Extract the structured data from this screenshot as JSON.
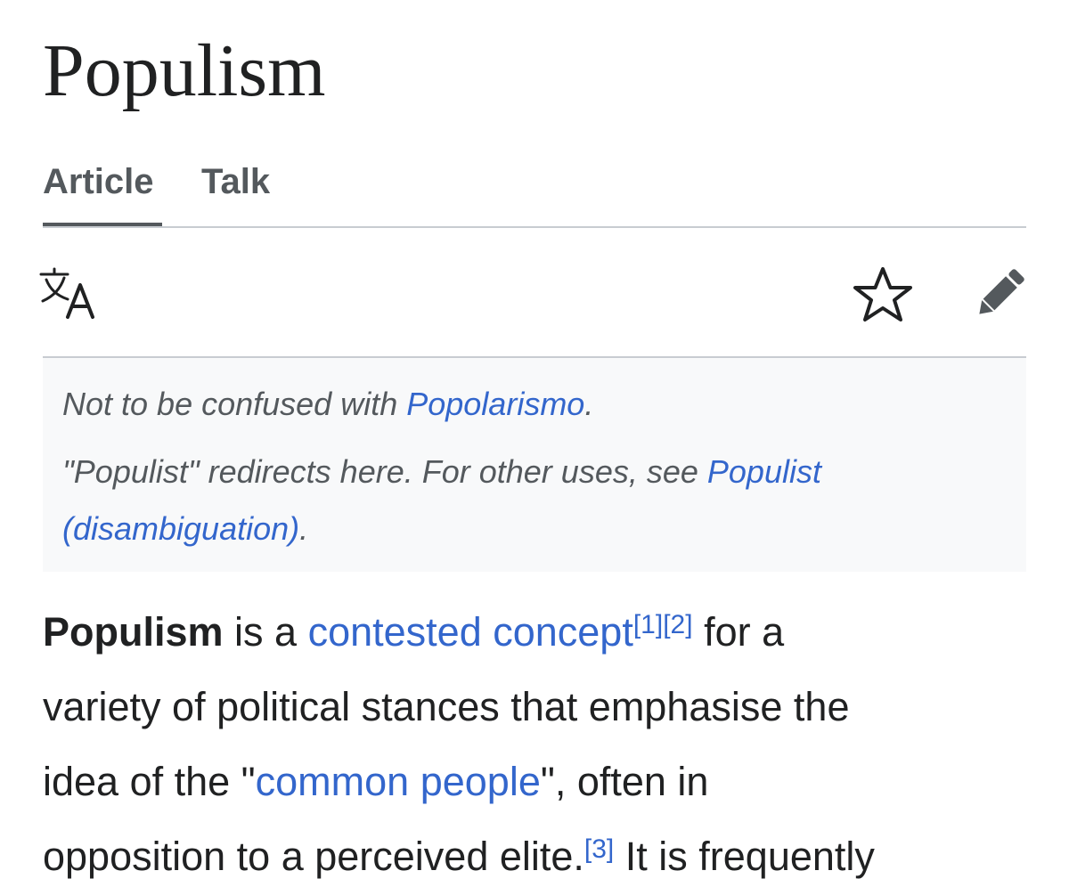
{
  "page": {
    "title": "Populism"
  },
  "tabs": [
    {
      "label": "Article",
      "selected": true
    },
    {
      "label": "Talk",
      "selected": false
    }
  ],
  "toolbar": {
    "language_icon": "translate-icon",
    "watch_icon": "star-icon",
    "edit_icon": "pencil-icon"
  },
  "hatnote": {
    "line1_prefix": "Not to be confused with ",
    "line1_link": "Popolarismo",
    "line1_suffix": ".",
    "line2_prefix": "\"Populist\" redirects here. For other uses, see ",
    "line2_link_part1": "Populist",
    "line2_link_part2": "(disambiguation)",
    "line2_suffix": "."
  },
  "body": {
    "bold_term": "Populism",
    "t1": " is a ",
    "link_contested": "contested concept",
    "ref1": "[1]",
    "ref2": "[2]",
    "t2": " for a",
    "line2": "variety of political stances that emphasise the",
    "t3": "idea of the \"",
    "link_common": "common people",
    "t4": "\", often in",
    "t5": "opposition to a perceived elite.",
    "ref3": "[3]",
    "t6": " It is frequently"
  },
  "colors": {
    "text": "#202122",
    "link": "#3366cc",
    "muted": "#54595d",
    "divider": "#c8ccd1",
    "hatnote_bg": "#f8f9fa"
  }
}
